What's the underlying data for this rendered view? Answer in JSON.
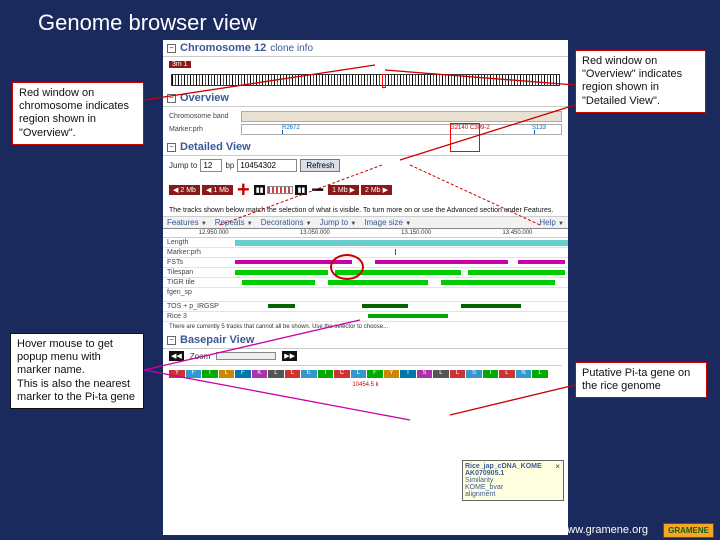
{
  "slide_title": "Genome browser view",
  "annotations": {
    "chrom_win": "Red window on chromosome indicates region shown in \"Overview\".",
    "overview_win": "Red window on \"Overview\" indicates region shown in \"Detailed View\".",
    "hover": "Hover mouse to get popup menu with marker name.\nThis is also the nearest marker to the Pi-ta gene",
    "pita": "Putative Pi-ta gene on the rice genome"
  },
  "chromosome": {
    "title": "Chromosome 12",
    "clone_link": "clone info",
    "scale": "3m 1"
  },
  "overview": {
    "title": "Overview",
    "band_label": "Chromosome band",
    "marker_track": "Marker:prh",
    "markers": {
      "left": "R2672",
      "mid1": "G2140",
      "mid2": "C309-2",
      "right": "S133"
    }
  },
  "detailed": {
    "title": "Detailed View",
    "jump_label": "Jump to",
    "jump_chr": "12",
    "jump_pos": "10454302",
    "refresh": "Refresh",
    "nav": {
      "left2": "2 Mb",
      "left1": "1 Mb",
      "right1": "1 Mb",
      "right2": "2 Mb"
    },
    "desc": "The tracks shown below match the selection of what is visible. To turn more on or use the Advanced section under Features.",
    "menus": [
      "Features",
      "Repeats",
      "Decorations",
      "Jump to",
      "Image size"
    ],
    "help": "Help",
    "coords": [
      "12.950.000",
      "13.050.000",
      "13.150.000",
      "13.450.000"
    ],
    "track_labels": [
      "Length",
      "Marker:prh",
      "FSTs",
      "Tilespan",
      "TIGR tile",
      "fgen_sp",
      "TOS + p_IRGSP",
      "Rice 3"
    ],
    "foot": "There are currently 5 tracks that cannot all be shown. Use the selector to choose..."
  },
  "tooltip": {
    "id1": "Rice_jap_cDNA_KOME",
    "id2": "AK070905.1",
    "links": [
      "Similarity",
      "KOME_bvar",
      "alignment"
    ]
  },
  "basepair": {
    "title": "Basepair View",
    "zoom": "Zoom",
    "seq": [
      "Y",
      "F",
      "T",
      "L",
      "F",
      "K",
      "L",
      "L",
      "E",
      "I",
      "C",
      "L",
      "F",
      "Y",
      "I",
      "S",
      "L",
      "L",
      "S",
      "I",
      "L",
      "N",
      "L"
    ],
    "coord": "10454.5 k"
  },
  "footer": {
    "url": "www.gramene.org",
    "logo": "GRAMENE"
  }
}
